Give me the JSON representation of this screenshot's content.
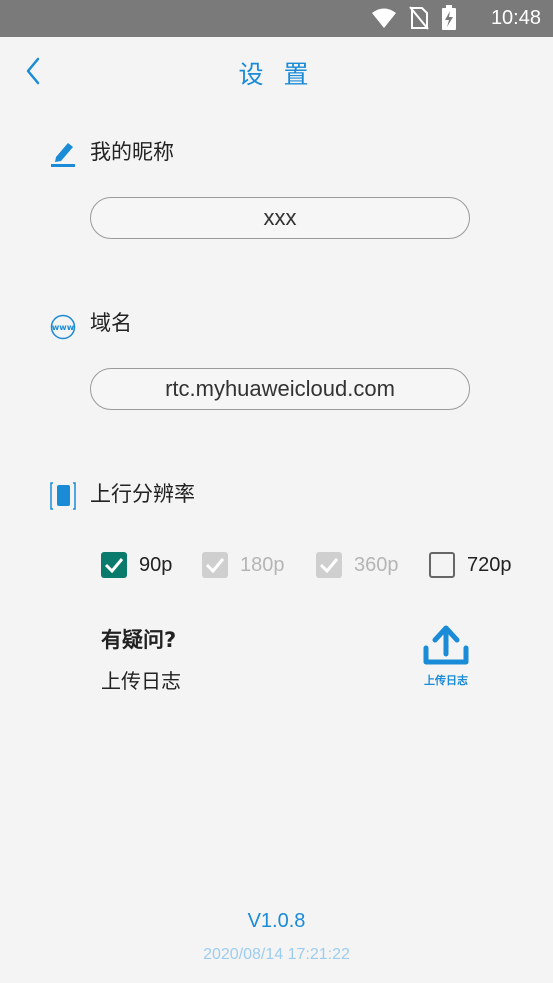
{
  "status_bar": {
    "time": "10:48",
    "icons": [
      "wifi-icon",
      "no-sim-icon",
      "battery-charging-icon"
    ]
  },
  "header": {
    "title": "设 置",
    "back_icon": "chevron-left-icon"
  },
  "nickname": {
    "label": "我的昵称",
    "icon": "edit-pencil-icon",
    "value": "xxx"
  },
  "domain": {
    "label": "域名",
    "icon": "www-globe-icon",
    "value": "rtc.myhuaweicloud.com"
  },
  "resolution": {
    "label": "上行分辨率",
    "icon": "phone-icon",
    "options": [
      {
        "label": "90p",
        "checked": true,
        "enabled": true
      },
      {
        "label": "180p",
        "checked": true,
        "enabled": false
      },
      {
        "label": "360p",
        "checked": true,
        "enabled": false
      },
      {
        "label": "720p",
        "checked": false,
        "enabled": true
      }
    ]
  },
  "help": {
    "title": "有疑问?",
    "subtitle": "上传日志",
    "upload_label": "上传日志",
    "upload_icon": "upload-icon"
  },
  "footer": {
    "version": "V1.0.8",
    "build_time": "2020/08/14 17:21:22"
  },
  "colors": {
    "accent": "#1a8bd6",
    "checkbox_checked": "#0a7a6c",
    "checkbox_disabled": "#cfcfcf",
    "status_bar": "#7a7a7a"
  }
}
